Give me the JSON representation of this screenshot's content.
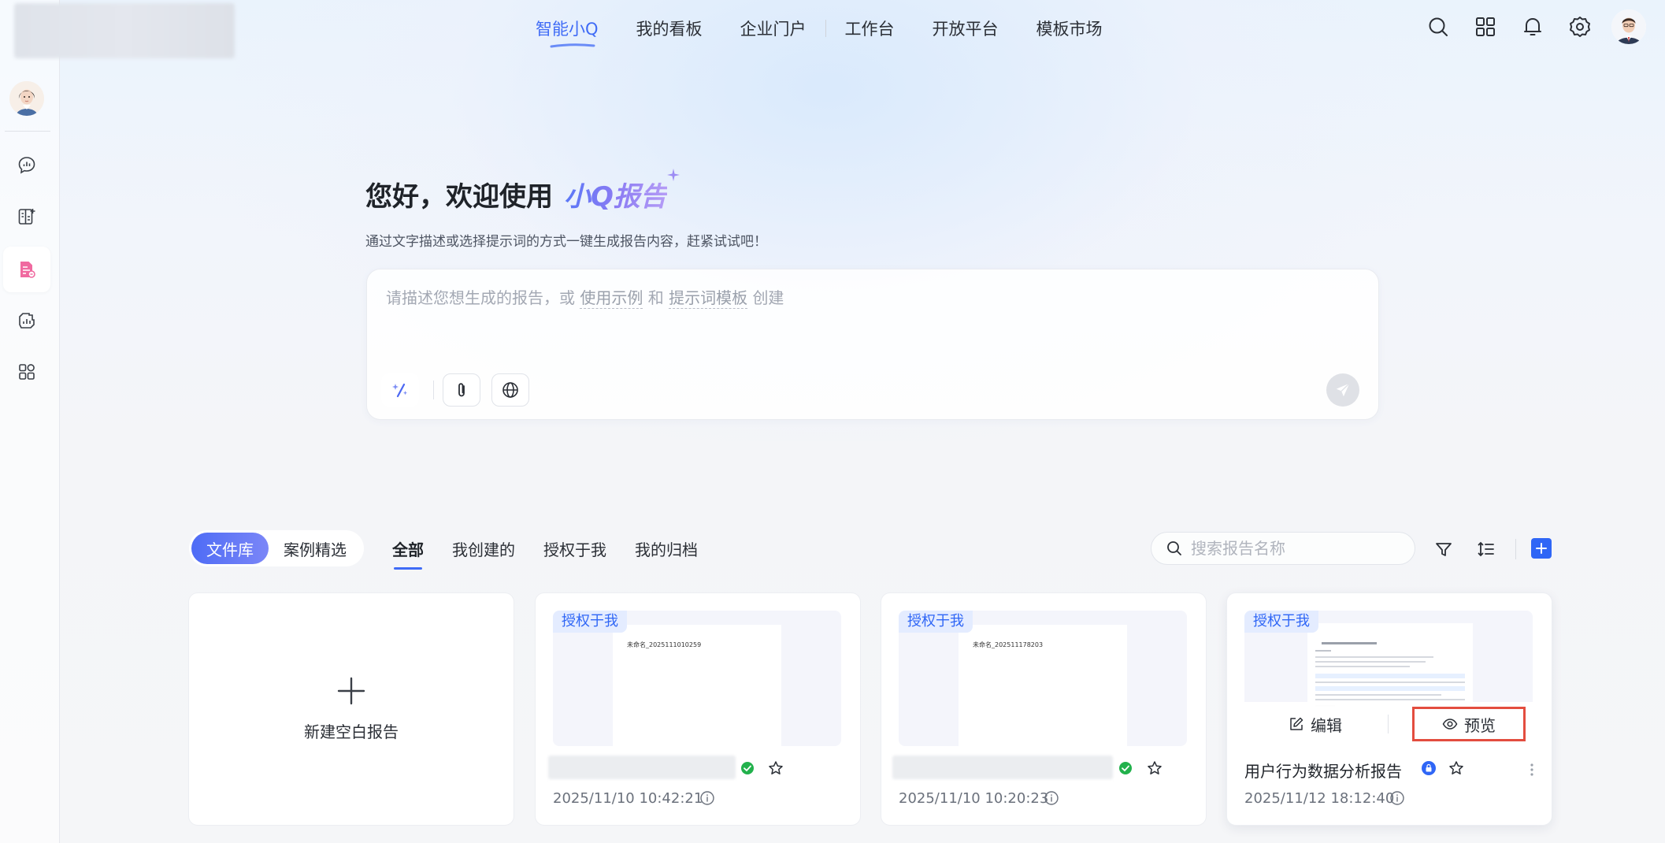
{
  "top_nav": {
    "items": [
      "智能小Q",
      "我的看板",
      "企业门户",
      "工作台",
      "开放平台",
      "模板市场"
    ],
    "active_index": 0
  },
  "hero": {
    "greeting": "您好，欢迎使用",
    "brand": "小Q报告",
    "subtitle": "通过文字描述或选择提示词的方式一键生成报告内容，赶紧试试吧！"
  },
  "prompt": {
    "prefix": "请描述您想生成的报告，或",
    "link_examples": "使用示例",
    "middle": "和",
    "link_templates": "提示词模板",
    "suffix": "创建"
  },
  "library": {
    "segments": [
      "文件库",
      "案例精选"
    ],
    "active_segment": 0,
    "tabs": [
      "全部",
      "我创建的",
      "授权于我",
      "我的归档"
    ],
    "active_tab": 0,
    "search_placeholder": "搜索报告名称"
  },
  "new_card": {
    "label": "新建空白报告"
  },
  "cards": [
    {
      "tag": "授权于我",
      "doc_title": "未命名_2025111010259",
      "date": "2025/11/10 10:42:21",
      "status": "success"
    },
    {
      "tag": "授权于我",
      "doc_title": "未命名_202511178203",
      "date": "2025/11/10 10:20:23",
      "status": "success"
    },
    {
      "tag": "授权于我",
      "name": "用户行为数据分析报告",
      "date": "2025/11/12 18:12:40",
      "edit_label": "编辑",
      "preview_label": "预览"
    }
  ],
  "colors": {
    "accent": "#3f6bf6",
    "highlight": "#e34d3f",
    "success": "#22b14c"
  }
}
